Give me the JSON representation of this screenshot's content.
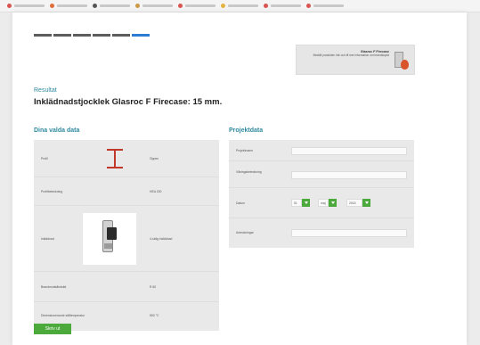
{
  "result": {
    "label": "Resultat",
    "title": "Inklädnadstjocklek Glasroc F Firecase: 15 mm."
  },
  "promo": {
    "title": "Glasroc F Firecase",
    "body": "Beställ produkten här och få mer information om brandskydd"
  },
  "left_section": {
    "title": "Dina valda data",
    "rows": [
      {
        "label": "Profil",
        "value": "Öppen"
      },
      {
        "label": "Profilbeteckning",
        "value": "HEA 200"
      },
      {
        "label": "Inklädnad",
        "value": "4-sidig inklädnad"
      },
      {
        "label": "Brandmotståndstid",
        "value": "R 60"
      },
      {
        "label": "Dimensionerande ståltemperatur",
        "value": "500 °C"
      }
    ]
  },
  "right_section": {
    "title": "Projektdata",
    "fields": [
      {
        "label": "Projektnamn",
        "value": ""
      },
      {
        "label": "Våningsbeteckning",
        "value": ""
      },
      {
        "label": "Datum",
        "value": ""
      },
      {
        "label": "Anteckningar",
        "value": ""
      }
    ],
    "date_parts": [
      "01",
      "maj",
      "2015"
    ]
  },
  "button": {
    "label": "Skriv ut"
  },
  "colors": {
    "accent": "#4caa3c",
    "heading": "#2f8a9e",
    "step_active": "#2c7bd4"
  },
  "icons": {
    "print": "print-icon",
    "share": "share-icon"
  }
}
